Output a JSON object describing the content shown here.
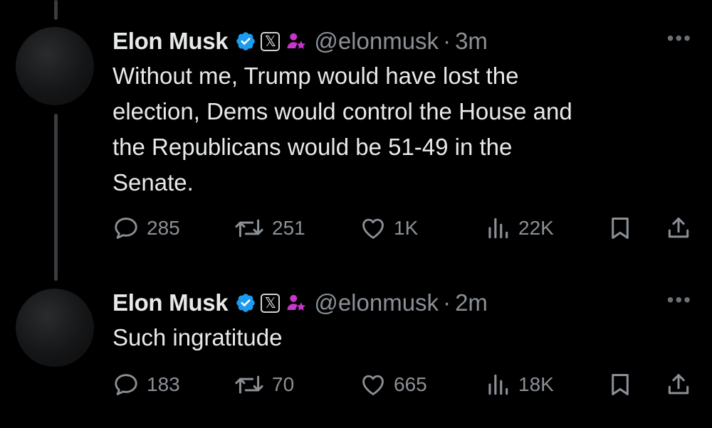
{
  "tweets": [
    {
      "name": "Elon Musk",
      "x_badge": "𝕏",
      "handle": "@elonmusk",
      "separator": "·",
      "time": "3m",
      "more": "•••",
      "text_lines": [
        "Without me, Trump would have lost the",
        "election, Dems would control the House and",
        "the Republicans would be 51-49 in the",
        "Senate."
      ],
      "stats": {
        "replies": "285",
        "reposts": "251",
        "likes": "1K",
        "views": "22K"
      }
    },
    {
      "name": "Elon Musk",
      "x_badge": "𝕏",
      "handle": "@elonmusk",
      "separator": "·",
      "time": "2m",
      "more": "•••",
      "text_lines": [
        "Such ingratitude"
      ],
      "stats": {
        "replies": "183",
        "reposts": "70",
        "likes": "665",
        "views": "18K"
      }
    }
  ],
  "colors": {
    "background": "#000000",
    "text": "#e7e9ea",
    "muted": "#8b9096",
    "verified": "#1d9bf0",
    "affiliate": "#c837c9"
  },
  "icons": [
    "verified-badge-icon",
    "x-badge-icon",
    "affiliate-badge-icon",
    "more-icon",
    "reply-icon",
    "repost-icon",
    "like-icon",
    "views-icon",
    "bookmark-icon",
    "share-icon"
  ]
}
